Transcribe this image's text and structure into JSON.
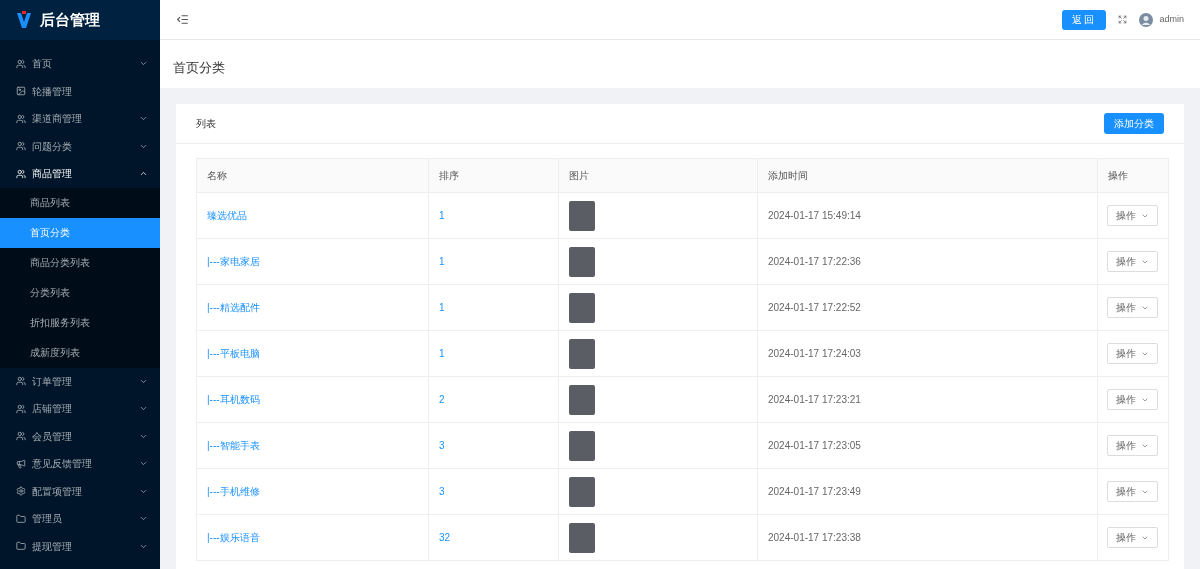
{
  "brand": {
    "title": "后台管理"
  },
  "sidebar": {
    "items": [
      {
        "label": "首页",
        "kind": "submenu",
        "expanded": false
      },
      {
        "label": "轮播管理",
        "kind": "link",
        "expanded": false
      },
      {
        "label": "渠道商管理",
        "kind": "submenu",
        "expanded": false
      },
      {
        "label": "问题分类",
        "kind": "submenu",
        "expanded": false
      },
      {
        "label": "商品管理",
        "kind": "submenu",
        "expanded": true,
        "children": [
          {
            "label": "商品列表",
            "selected": false
          },
          {
            "label": "首页分类",
            "selected": true
          },
          {
            "label": "商品分类列表",
            "selected": false
          },
          {
            "label": "分类列表",
            "selected": false
          },
          {
            "label": "折扣服务列表",
            "selected": false
          },
          {
            "label": "成新度列表",
            "selected": false
          }
        ]
      },
      {
        "label": "订单管理",
        "kind": "submenu",
        "expanded": false
      },
      {
        "label": "店铺管理",
        "kind": "submenu",
        "expanded": false
      },
      {
        "label": "会员管理",
        "kind": "submenu",
        "expanded": false
      },
      {
        "label": "意见反馈管理",
        "kind": "submenu",
        "expanded": false
      },
      {
        "label": "配置项管理",
        "kind": "submenu",
        "expanded": false
      },
      {
        "label": "管理员",
        "kind": "submenu",
        "expanded": false
      },
      {
        "label": "提现管理",
        "kind": "submenu",
        "expanded": false
      }
    ]
  },
  "header": {
    "back_button": "返回",
    "user": "admin"
  },
  "page_title": "首页分类",
  "card": {
    "title": "列表",
    "add_button": "添加分类"
  },
  "table": {
    "columns": [
      "名称",
      "排序",
      "图片",
      "添加时间",
      "操作"
    ],
    "rows": [
      {
        "name": "臻选优品",
        "sort": "1",
        "time": "2024-01-17 15:49:14",
        "action": "操作"
      },
      {
        "name": "|---家电家居",
        "sort": "1",
        "time": "2024-01-17 17:22:36",
        "action": "操作"
      },
      {
        "name": "|---精选配件",
        "sort": "1",
        "time": "2024-01-17 17:22:52",
        "action": "操作"
      },
      {
        "name": "|---平板电脑",
        "sort": "1",
        "time": "2024-01-17 17:24:03",
        "action": "操作"
      },
      {
        "name": "|---耳机数码",
        "sort": "2",
        "time": "2024-01-17 17:23:21",
        "action": "操作"
      },
      {
        "name": "|---智能手表",
        "sort": "3",
        "time": "2024-01-17 17:23:05",
        "action": "操作"
      },
      {
        "name": "|---手机维修",
        "sort": "3",
        "time": "2024-01-17 17:23:49",
        "action": "操作"
      },
      {
        "name": "|---娱乐语音",
        "sort": "32",
        "time": "2024-01-17 17:23:38",
        "action": "操作"
      }
    ]
  }
}
